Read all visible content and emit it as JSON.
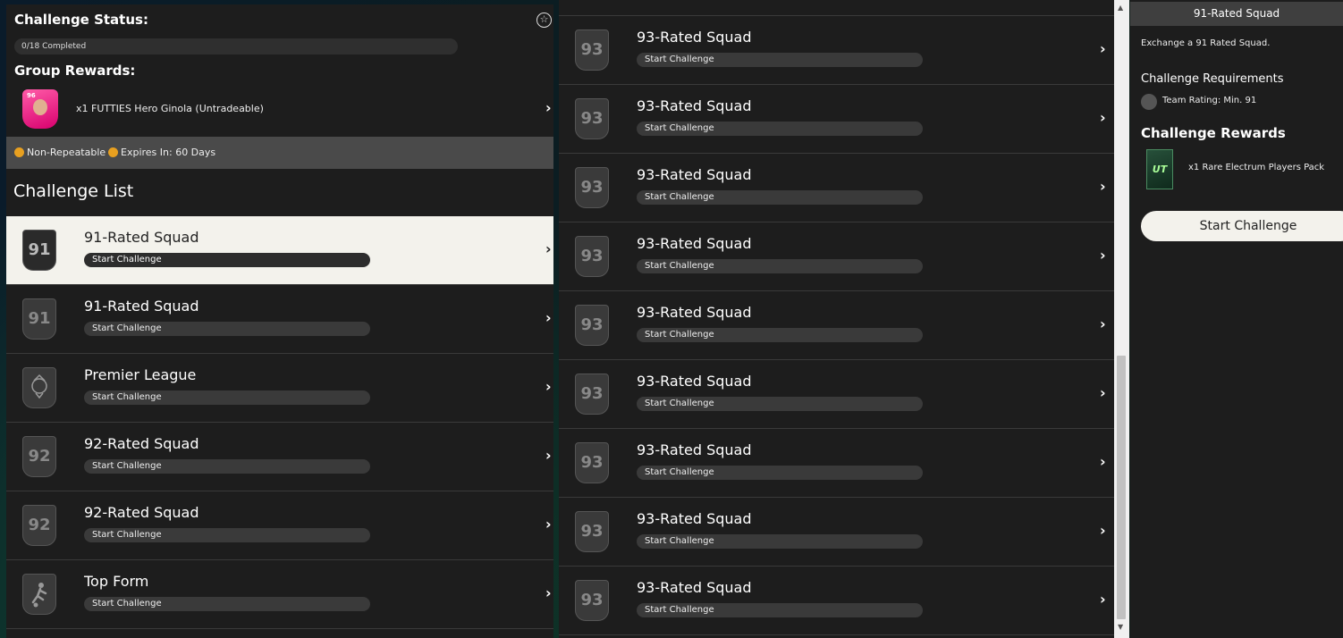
{
  "left": {
    "status_title": "Challenge Status:",
    "progress_text": "0/18 Completed",
    "group_rewards_title": "Group Rewards:",
    "reward_label": "x1 FUTTIES Hero Ginola (Untradeable)",
    "reward_card_rating": "96",
    "non_repeatable": "Non-Repeatable",
    "expires": "Expires In: 60 Days",
    "list_title": "Challenge List",
    "rows": [
      {
        "badge": "91",
        "title": "91-Rated Squad",
        "action": "Start Challenge"
      },
      {
        "badge": "91",
        "title": "91-Rated Squad",
        "action": "Start Challenge"
      },
      {
        "badge": "",
        "title": "Premier League",
        "action": "Start Challenge"
      },
      {
        "badge": "92",
        "title": "92-Rated Squad",
        "action": "Start Challenge"
      },
      {
        "badge": "92",
        "title": "92-Rated Squad",
        "action": "Start Challenge"
      },
      {
        "badge": "",
        "title": "Top Form",
        "action": "Start Challenge"
      }
    ]
  },
  "middle": {
    "rows": [
      {
        "badge": "93",
        "title": "93-Rated Squad",
        "action": "Start Challenge"
      },
      {
        "badge": "93",
        "title": "93-Rated Squad",
        "action": "Start Challenge"
      },
      {
        "badge": "93",
        "title": "93-Rated Squad",
        "action": "Start Challenge"
      },
      {
        "badge": "93",
        "title": "93-Rated Squad",
        "action": "Start Challenge"
      },
      {
        "badge": "93",
        "title": "93-Rated Squad",
        "action": "Start Challenge"
      },
      {
        "badge": "93",
        "title": "93-Rated Squad",
        "action": "Start Challenge"
      },
      {
        "badge": "93",
        "title": "93-Rated Squad",
        "action": "Start Challenge"
      },
      {
        "badge": "93",
        "title": "93-Rated Squad",
        "action": "Start Challenge"
      },
      {
        "badge": "93",
        "title": "93-Rated Squad",
        "action": "Start Challenge"
      }
    ]
  },
  "right": {
    "title": "91-Rated Squad",
    "description": "Exchange a 91 Rated Squad.",
    "requirements_title": "Challenge Requirements",
    "requirement": "Team Rating: Min. 91",
    "rewards_title": "Challenge Rewards",
    "pack_label": "x1 Rare Electrum Players Pack",
    "pack_logo": "UT",
    "start_button": "Start Challenge"
  },
  "icons": {
    "chevron": "›",
    "star": "☆"
  }
}
